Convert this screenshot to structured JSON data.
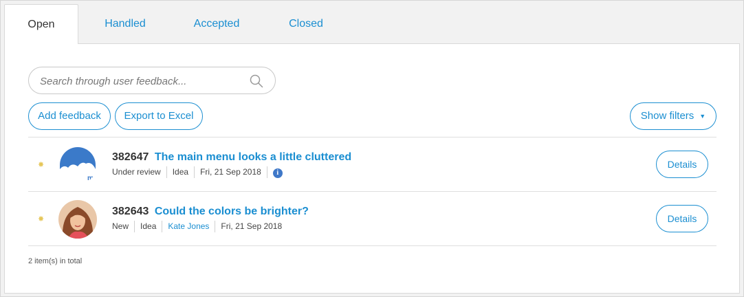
{
  "tabs": [
    {
      "label": "Open",
      "active": true
    },
    {
      "label": "Handled",
      "active": false
    },
    {
      "label": "Accepted",
      "active": false
    },
    {
      "label": "Closed",
      "active": false
    }
  ],
  "search": {
    "placeholder": "Search through user feedback...",
    "icon": "search-icon"
  },
  "toolbar": {
    "add_label": "Add feedback",
    "export_label": "Export to Excel",
    "filters_label": "Show filters",
    "filters_caret": "▼"
  },
  "items": [
    {
      "id": "382647",
      "title": "The main menu looks a little cluttered",
      "status": "Under review",
      "type": "Idea",
      "date": "Fri, 21 Sep 2018",
      "has_info": true,
      "info_glyph": "i",
      "avatar": "mx-logo",
      "avatar_text": "mx",
      "details_label": "Details"
    },
    {
      "id": "382643",
      "title": "Could the colors be brighter?",
      "status": "New",
      "type": "Idea",
      "author": "Kate Jones",
      "date": "Fri, 21 Sep 2018",
      "avatar": "user-photo",
      "details_label": "Details"
    }
  ],
  "footer": {
    "total": "2 item(s) in total"
  },
  "colors": {
    "accent": "#1a8ed1",
    "star": "#e6c75a",
    "info": "#3f78c8"
  }
}
